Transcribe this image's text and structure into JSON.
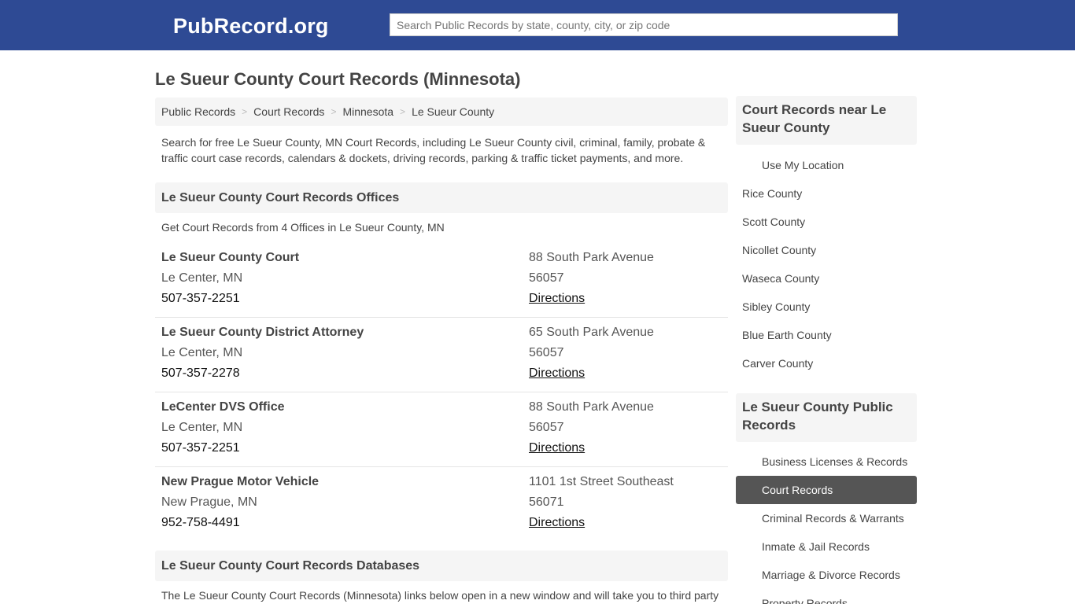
{
  "header": {
    "logo": "PubRecord.org",
    "search_placeholder": "Search Public Records by state, county, city, or zip code"
  },
  "page_title": "Le Sueur County Court Records (Minnesota)",
  "breadcrumb": [
    "Public Records",
    "Court Records",
    "Minnesota",
    "Le Sueur County"
  ],
  "intro": "Search for free Le Sueur County, MN Court Records, including Le Sueur County civil, criminal, family, probate & traffic court case records, calendars & dockets, driving records, parking & traffic ticket payments, and more.",
  "offices_section": {
    "title": "Le Sueur County Court Records Offices",
    "subtitle": "Get Court Records from 4 Offices in Le Sueur County, MN",
    "offices": [
      {
        "name": "Le Sueur County Court",
        "city": "Le Center, MN",
        "phone": "507-357-2251",
        "street": "88 South Park Avenue",
        "zip": "56057",
        "directions": "Directions"
      },
      {
        "name": "Le Sueur County District Attorney",
        "city": "Le Center, MN",
        "phone": "507-357-2278",
        "street": "65 South Park Avenue",
        "zip": "56057",
        "directions": "Directions"
      },
      {
        "name": "LeCenter DVS Office",
        "city": "Le Center, MN",
        "phone": "507-357-2251",
        "street": "88 South Park Avenue",
        "zip": "56057",
        "directions": "Directions"
      },
      {
        "name": "New Prague Motor Vehicle",
        "city": "New Prague, MN",
        "phone": "952-758-4491",
        "street": "1101 1st Street Southeast",
        "zip": "56071",
        "directions": "Directions"
      }
    ]
  },
  "databases_section": {
    "title": "Le Sueur County Court Records Databases",
    "text": "The Le Sueur County Court Records (Minnesota) links below open in a new window and will take you to third party"
  },
  "sidebar": {
    "nearby": {
      "title": "Court Records near Le Sueur County",
      "use_location": "Use My Location",
      "items": [
        "Rice County",
        "Scott County",
        "Nicollet County",
        "Waseca County",
        "Sibley County",
        "Blue Earth County",
        "Carver County"
      ]
    },
    "public_records": {
      "title": "Le Sueur County Public Records",
      "items": [
        "Business Licenses & Records",
        "Court Records",
        "Criminal Records & Warrants",
        "Inmate & Jail Records",
        "Marriage & Divorce Records",
        "Property Records"
      ],
      "active": "Court Records"
    }
  }
}
